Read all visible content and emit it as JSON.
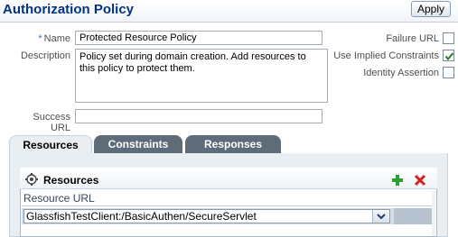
{
  "header": {
    "title": "Authorization Policy",
    "apply_label": "Apply"
  },
  "form": {
    "name_required_marker": "*",
    "name_label": "Name",
    "name_value": "Protected Resource Policy",
    "description_label": "Description",
    "description_value": "Policy set during domain creation. Add resources to this policy to protect them.",
    "success_url_label": "Success URL",
    "success_url_value": "",
    "failure_url_label": "Failure URL",
    "failure_url_checked": false,
    "use_implied_constraints_label": "Use Implied Constraints",
    "use_implied_constraints_checked": true,
    "identity_assertion_label": "Identity Assertion",
    "identity_assertion_checked": false
  },
  "tabs": [
    {
      "label": "Resources",
      "active": true
    },
    {
      "label": "Constraints",
      "active": false
    },
    {
      "label": "Responses",
      "active": false
    }
  ],
  "resources": {
    "title": "Resources",
    "column_header": "Resource URL",
    "rows": [
      {
        "url": "GlassfishTestClient:/BasicAuthen/SecureServlet"
      }
    ]
  },
  "colors": {
    "title": "#003286",
    "add_icon": "#2e9e2e",
    "delete_icon": "#d31f1f",
    "tab_dark": "#5e6b78"
  }
}
